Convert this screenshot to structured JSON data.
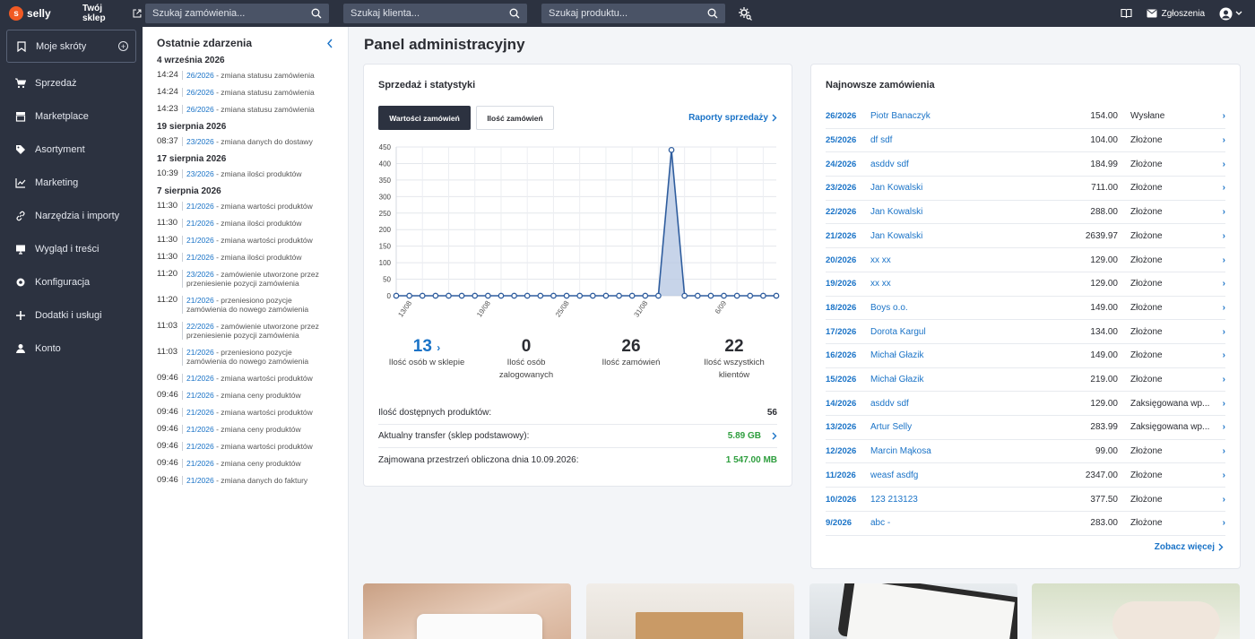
{
  "topbar": {
    "logo_text": "selly",
    "shop_label": "Twój sklep",
    "search_orders": "Szukaj zamówienia...",
    "search_clients": "Szukaj klienta...",
    "search_products": "Szukaj produktu...",
    "reports_label": "Zgłoszenia"
  },
  "sidebar": {
    "items": [
      {
        "label": "Moje skróty",
        "icon": "bookmark-icon"
      },
      {
        "label": "Sprzedaż",
        "icon": "cart-icon"
      },
      {
        "label": "Marketplace",
        "icon": "store-icon"
      },
      {
        "label": "Asortyment",
        "icon": "tag-icon"
      },
      {
        "label": "Marketing",
        "icon": "chart-line-icon"
      },
      {
        "label": "Narzędzia i importy",
        "icon": "link-icon"
      },
      {
        "label": "Wygląd i treści",
        "icon": "monitor-icon"
      },
      {
        "label": "Konfiguracja",
        "icon": "gear-icon"
      },
      {
        "label": "Dodatki i usługi",
        "icon": "plus-icon"
      },
      {
        "label": "Konto",
        "icon": "user-icon"
      }
    ]
  },
  "events": {
    "title": "Ostatnie zdarzenia",
    "groups": [
      {
        "date": "4 września 2026",
        "items": [
          {
            "time": "14:24",
            "ref": "26/2026",
            "text": " - zmiana statusu zamówienia"
          },
          {
            "time": "14:24",
            "ref": "26/2026",
            "text": " - zmiana statusu zamówienia"
          },
          {
            "time": "14:23",
            "ref": "26/2026",
            "text": " - zmiana statusu zamówienia"
          }
        ]
      },
      {
        "date": "19 sierpnia 2026",
        "items": [
          {
            "time": "08:37",
            "ref": "23/2026",
            "text": " - zmiana danych do dostawy"
          }
        ]
      },
      {
        "date": "17 sierpnia 2026",
        "items": [
          {
            "time": "10:39",
            "ref": "23/2026",
            "text": " - zmiana ilości produktów"
          }
        ]
      },
      {
        "date": "7 sierpnia 2026",
        "items": [
          {
            "time": "11:30",
            "ref": "21/2026",
            "text": " - zmiana wartości produktów"
          },
          {
            "time": "11:30",
            "ref": "21/2026",
            "text": " - zmiana ilości produktów"
          },
          {
            "time": "11:30",
            "ref": "21/2026",
            "text": " - zmiana wartości produktów"
          },
          {
            "time": "11:30",
            "ref": "21/2026",
            "text": " - zmiana ilości produktów"
          },
          {
            "time": "11:20",
            "ref": "23/2026",
            "text": " - zamówienie utworzone przez przeniesienie pozycji zamówienia"
          },
          {
            "time": "11:20",
            "ref": "21/2026",
            "text": " - przeniesiono pozycje zamówienia do nowego zamówienia"
          },
          {
            "time": "11:03",
            "ref": "22/2026",
            "text": " - zamówienie utworzone przez przeniesienie pozycji zamówienia"
          },
          {
            "time": "11:03",
            "ref": "21/2026",
            "text": " - przeniesiono pozycje zamówienia do nowego zamówienia"
          },
          {
            "time": "09:46",
            "ref": "21/2026",
            "text": " - zmiana wartości produktów"
          },
          {
            "time": "09:46",
            "ref": "21/2026",
            "text": " - zmiana ceny produktów"
          },
          {
            "time": "09:46",
            "ref": "21/2026",
            "text": " - zmiana wartości produktów"
          },
          {
            "time": "09:46",
            "ref": "21/2026",
            "text": " - zmiana ceny produktów"
          },
          {
            "time": "09:46",
            "ref": "21/2026",
            "text": " - zmiana wartości produktów"
          },
          {
            "time": "09:46",
            "ref": "21/2026",
            "text": " - zmiana ceny produktów"
          },
          {
            "time": "09:46",
            "ref": "21/2026",
            "text": " - zmiana danych do faktury"
          }
        ]
      }
    ]
  },
  "main": {
    "title": "Panel administracyjny"
  },
  "sales": {
    "title": "Sprzedaż i statystyki",
    "tab_values": "Wartości zamówień",
    "tab_count": "Ilość zamówień",
    "reports_link": "Raporty sprzedaży",
    "stats": [
      {
        "value": "13",
        "label": "Ilość osób w sklepie"
      },
      {
        "value": "0",
        "label": "Ilość osób zalogowanych"
      },
      {
        "value": "26",
        "label": "Ilość zamówień"
      },
      {
        "value": "22",
        "label": "Ilość wszystkich klientów"
      }
    ],
    "info": [
      {
        "label": "Ilość dostępnych produktów:",
        "value": "56"
      },
      {
        "label": "Aktualny transfer (sklep podstawowy):",
        "value": "5.89 GB"
      },
      {
        "label": "Zajmowana przestrzeń obliczona dnia 10.09.2026:",
        "value": "1 547.00 MB"
      }
    ]
  },
  "chart_data": {
    "type": "area",
    "x_ticks": [
      "13/08",
      "19/08",
      "25/08",
      "31/08",
      "6/09"
    ],
    "x": [
      "12/08",
      "13/08",
      "14/08",
      "15/08",
      "16/08",
      "17/08",
      "18/08",
      "19/08",
      "20/08",
      "21/08",
      "22/08",
      "23/08",
      "24/08",
      "25/08",
      "26/08",
      "27/08",
      "28/08",
      "29/08",
      "30/08",
      "31/08",
      "01/09",
      "02/09",
      "03/09",
      "04/09",
      "05/09",
      "06/09",
      "07/09",
      "08/09",
      "09/09",
      "10/09"
    ],
    "values": [
      0,
      0,
      0,
      0,
      0,
      0,
      0,
      0,
      0,
      0,
      0,
      0,
      0,
      0,
      0,
      0,
      0,
      0,
      0,
      0,
      0,
      441,
      0,
      0,
      0,
      0,
      0,
      0,
      0,
      0
    ],
    "ylim": [
      0,
      450
    ],
    "y_ticks": [
      0,
      50,
      100,
      150,
      200,
      250,
      300,
      350,
      400,
      450
    ],
    "grid": true,
    "colors": {
      "line": "#2f5d9e",
      "fill": "#b9c9e3"
    }
  },
  "orders": {
    "title": "Najnowsze zamówienia",
    "more_link": "Zobacz więcej",
    "rows": [
      {
        "no": "26/2026",
        "client": "Piotr Banaczyk",
        "amount": "154.00",
        "status": "Wysłane"
      },
      {
        "no": "25/2026",
        "client": "df sdf",
        "amount": "104.00",
        "status": "Złożone"
      },
      {
        "no": "24/2026",
        "client": "asddv sdf",
        "amount": "184.99",
        "status": "Złożone"
      },
      {
        "no": "23/2026",
        "client": "Jan Kowalski",
        "amount": "711.00",
        "status": "Złożone"
      },
      {
        "no": "22/2026",
        "client": "Jan Kowalski",
        "amount": "288.00",
        "status": "Złożone"
      },
      {
        "no": "21/2026",
        "client": "Jan Kowalski",
        "amount": "2639.97",
        "status": "Złożone"
      },
      {
        "no": "20/2026",
        "client": "xx xx",
        "amount": "129.00",
        "status": "Złożone"
      },
      {
        "no": "19/2026",
        "client": "xx xx",
        "amount": "129.00",
        "status": "Złożone"
      },
      {
        "no": "18/2026",
        "client": "Boys o.o.",
        "amount": "149.00",
        "status": "Złożone"
      },
      {
        "no": "17/2026",
        "client": "Dorota Kargul",
        "amount": "134.00",
        "status": "Złożone"
      },
      {
        "no": "16/2026",
        "client": "Michał Głazik",
        "amount": "149.00",
        "status": "Złożone"
      },
      {
        "no": "15/2026",
        "client": "Michał Głazik",
        "amount": "219.00",
        "status": "Złożone"
      },
      {
        "no": "14/2026",
        "client": "asddv sdf",
        "amount": "129.00",
        "status": "Zaksięgowana wp..."
      },
      {
        "no": "13/2026",
        "client": "Artur Selly",
        "amount": "283.99",
        "status": "Zaksięgowana wp..."
      },
      {
        "no": "12/2026",
        "client": "Marcin Mąkosa",
        "amount": "99.00",
        "status": "Złożone"
      },
      {
        "no": "11/2026",
        "client": "weasf asdfg",
        "amount": "2347.00",
        "status": "Złożone"
      },
      {
        "no": "10/2026",
        "client": "123 213123",
        "amount": "377.50",
        "status": "Złożone"
      },
      {
        "no": "9/2026",
        "client": "abc -",
        "amount": "283.00",
        "status": "Złożone"
      }
    ]
  },
  "colors": {
    "topbar": "#2c3240",
    "accent": "#1a73c7",
    "brand": "#f15a24",
    "success": "#2e9e3e"
  }
}
